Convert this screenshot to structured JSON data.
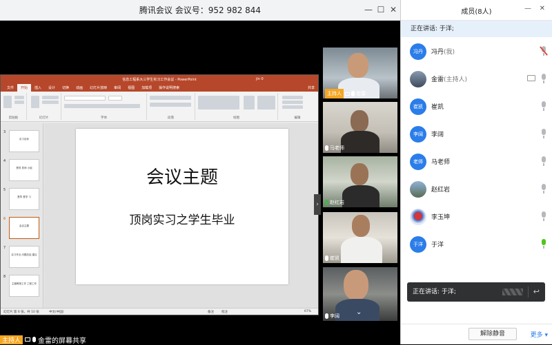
{
  "window": {
    "title": "腾讯会议 会议号：952 982 844",
    "minimize_icon": "—",
    "maximize_icon": "☐",
    "close_icon": "✕"
  },
  "ppt": {
    "title": "信息工程系大三学生实习工作会议 - PowerPoint",
    "user": "jin 0",
    "tabs": [
      "文件",
      "开始",
      "插入",
      "设计",
      "切换",
      "动画",
      "幻灯片放映",
      "审阅",
      "视图",
      "加载项",
      "操作说明搜索"
    ],
    "share_label": "共享",
    "ribbon_groups": [
      "剪贴板",
      "幻灯片",
      "字体",
      "段落",
      "绘图",
      "编辑"
    ],
    "thumbnails": [
      {
        "num": "3",
        "text": "实习目标"
      },
      {
        "num": "4",
        "text": "督导 导师 小组"
      },
      {
        "num": "5",
        "text": "督导 督学 习"
      },
      {
        "num": "6",
        "text": "会议主题"
      },
      {
        "num": "7",
        "text": "实习作业 问题总结 建议"
      },
      {
        "num": "8",
        "text": "主管教授工作 工程工作"
      }
    ],
    "slide_title": "会议主题",
    "slide_subtitle": "顶岗实习之学生毕业",
    "status_left": "幻灯片 第 6 张，共 10 张",
    "status_lang": "中文(中国)",
    "status_notes": "备注",
    "status_comments": "批注",
    "status_zoom": "67%"
  },
  "videos": [
    {
      "name": "金雷",
      "host": true,
      "host_label": "主持人"
    },
    {
      "name": "马老师",
      "host": false
    },
    {
      "name": "赵红岩",
      "host": false,
      "mic_active": true
    },
    {
      "name": "崔凯",
      "host": false
    },
    {
      "name": "李阔",
      "host": false
    }
  ],
  "sharebar": {
    "host_label": "主持人",
    "text": "金雷的屏幕共享"
  },
  "panel": {
    "title": "成员(8人)",
    "min_icon": "—",
    "close_icon": "✕",
    "speaking": "正在讲话: 于洋;",
    "members": [
      {
        "avatar": "冯丹",
        "name": "冯丹",
        "tag": "(我)",
        "mic": "muted",
        "photo": ""
      },
      {
        "avatar": "",
        "name": "金雷",
        "tag": "(主持人)",
        "mic": "normal",
        "photo": "photo1",
        "sharing": true
      },
      {
        "avatar": "崔凯",
        "name": "崔凯",
        "tag": "",
        "mic": "normal",
        "photo": ""
      },
      {
        "avatar": "李阔",
        "name": "李阔",
        "tag": "",
        "mic": "normal",
        "photo": ""
      },
      {
        "avatar": "老师",
        "name": "马老师",
        "tag": "",
        "mic": "normal",
        "photo": ""
      },
      {
        "avatar": "",
        "name": "赵红岩",
        "tag": "",
        "mic": "normal",
        "photo": "photo2"
      },
      {
        "avatar": "",
        "name": "李玉坤",
        "tag": "",
        "mic": "normal",
        "photo": "photo3"
      },
      {
        "avatar": "于洋",
        "name": "于洋",
        "tag": "",
        "mic": "active",
        "photo": ""
      }
    ],
    "toast": "正在讲话: 于洋;",
    "unmute_label": "解除静音",
    "more_label": "更多 ▾"
  }
}
